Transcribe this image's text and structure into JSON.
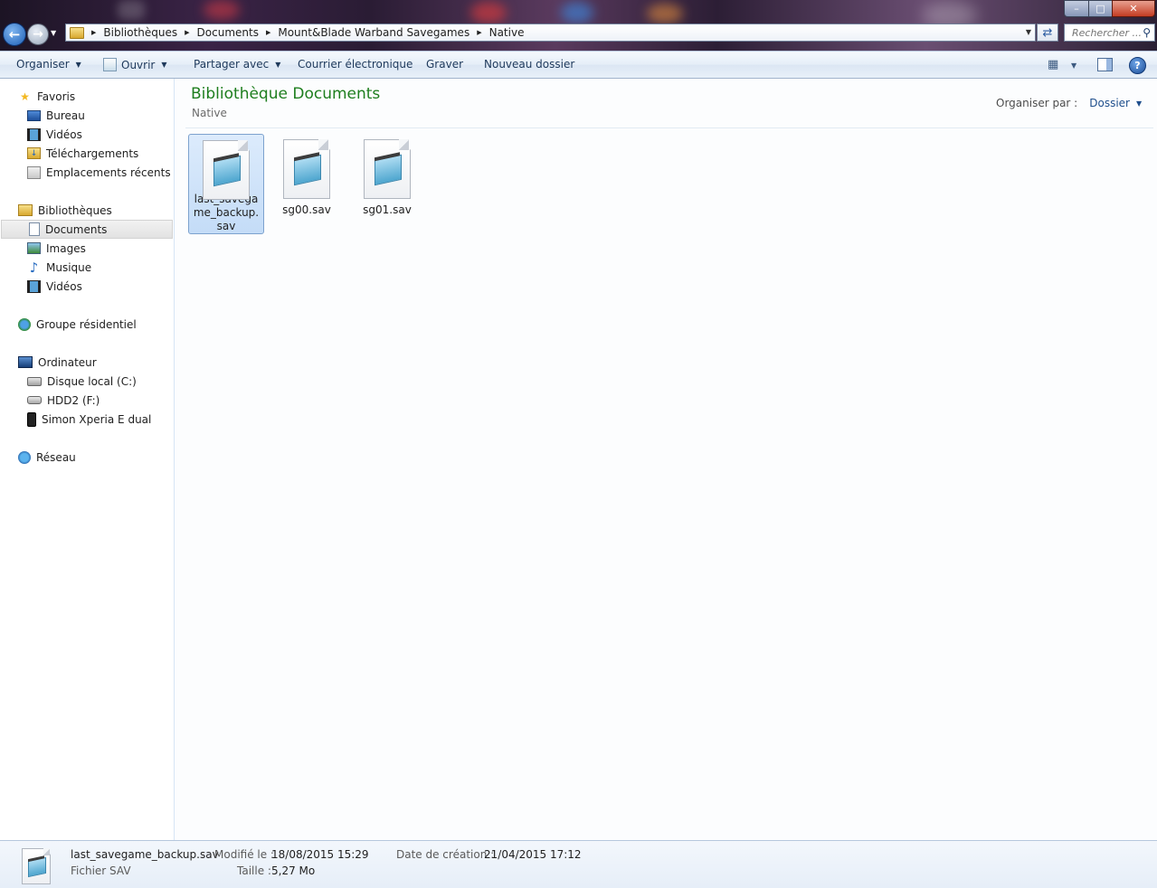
{
  "window": {
    "minimize_glyph": "–",
    "maximize_glyph": "□",
    "close_glyph": "✕"
  },
  "address": {
    "breadcrumbs": [
      "Bibliothèques",
      "Documents",
      "Mount&Blade Warband Savegames",
      "Native"
    ],
    "search_placeholder": "Rechercher ..."
  },
  "toolbar": {
    "organize_label": "Organiser",
    "open_label": "Ouvrir",
    "share_label": "Partager avec",
    "email_label": "Courrier électronique",
    "burn_label": "Graver",
    "new_folder_label": "Nouveau dossier"
  },
  "sidebar": {
    "favorites": {
      "label": "Favoris",
      "items": [
        "Bureau",
        "Vidéos",
        "Téléchargements",
        "Emplacements récents"
      ]
    },
    "libraries": {
      "label": "Bibliothèques",
      "items": [
        "Documents",
        "Images",
        "Musique",
        "Vidéos"
      ],
      "selected": "Documents"
    },
    "homegroup": {
      "label": "Groupe résidentiel"
    },
    "computer": {
      "label": "Ordinateur",
      "items": [
        "Disque local (C:)",
        "HDD2 (F:)",
        "Simon Xperia E dual"
      ]
    },
    "network": {
      "label": "Réseau"
    }
  },
  "content": {
    "title": "Bibliothèque Documents",
    "subtitle": "Native",
    "arrange_label": "Organiser par :",
    "arrange_value": "Dossier",
    "files": [
      {
        "name": "last_savegame_backup.sav",
        "selected": true
      },
      {
        "name": "sg00.sav",
        "selected": false
      },
      {
        "name": "sg01.sav",
        "selected": false
      }
    ]
  },
  "details": {
    "name": "last_savegame_backup.sav",
    "type": "Fichier SAV",
    "modified_label": "Modifié le :",
    "modified_value": "18/08/2015 15:29",
    "size_label": "Taille :",
    "size_value": "5,27 Mo",
    "created_label": "Date de création :",
    "created_value": "21/04/2015 17:12"
  }
}
